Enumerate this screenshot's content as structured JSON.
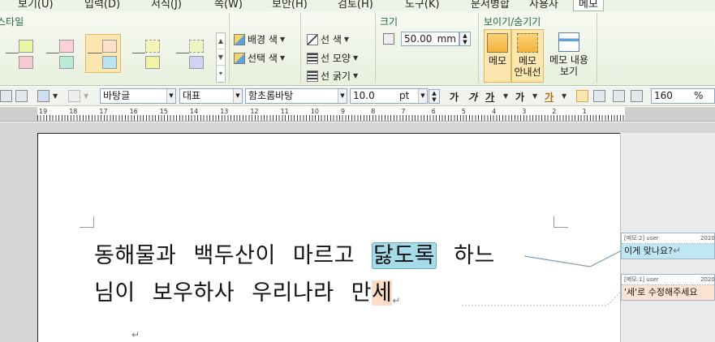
{
  "menu": {
    "items": [
      "보기(U)",
      "입력(D)",
      "서식(J)",
      "쪽(W)",
      "보안(H)",
      "검토(H)",
      "도구(K)",
      "문서병합",
      "사용자",
      "메모"
    ],
    "active": "메모"
  },
  "ribbon": {
    "styles_group_title": "스타일",
    "bg_color": "배경 색",
    "select_color": "선택 색",
    "line_color": "선 색",
    "line_shape": "선 모양",
    "line_thickness": "선 굵기",
    "size_group_title": "크기",
    "size_value": "50.00",
    "size_unit": "mm",
    "show_hide_title": "보이기/숨기기",
    "btn_memo": "메모",
    "btn_memo_guide_1": "메모",
    "btn_memo_guide_2": "안내선",
    "btn_memo_content_1": "메모 내용",
    "btn_memo_content_2": "보기"
  },
  "format": {
    "style": "바탕글",
    "lang": "대표",
    "font": "함초롬바탕",
    "size": "10.0",
    "size_unit": "pt",
    "bold": "가",
    "italic": "가",
    "underline": "가",
    "strike": "가",
    "color": "가",
    "line_spacing": "160",
    "line_spacing_unit": "%"
  },
  "ruler": {
    "labels": [
      "19",
      "18",
      "17",
      "16",
      "15",
      "14",
      "13",
      "12",
      "11",
      "10",
      "9",
      "8",
      "7",
      "6",
      "5",
      "4",
      "3",
      "2",
      "1"
    ]
  },
  "document": {
    "line1_before": "동해물과 백두산이 마르고",
    "line1_highlight": "닳도록",
    "line1_after": "하느",
    "line2_before": "님이 보우하사 우리나라 만",
    "line2_highlight": "세"
  },
  "memos": [
    {
      "header": "[메모:2] user",
      "year": "2020",
      "text": "이게 맞나요?"
    },
    {
      "header": "[메모:1] user",
      "year": "2020",
      "text": "'세'로 수정해주세요"
    }
  ],
  "colors": {
    "accent": "#1c6a3a",
    "highlight_blue": "#a6dbe9",
    "highlight_peach": "#fbdcc6",
    "ribbon_bg": "#e9f0df"
  }
}
